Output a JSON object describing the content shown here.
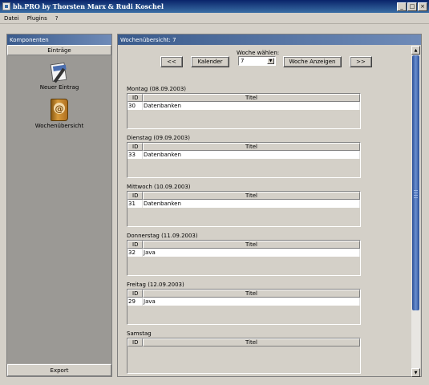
{
  "window": {
    "title": "bh.PRO by Thorsten Marx & Rudi Koschel",
    "min": "_",
    "max": "□",
    "close": "×"
  },
  "menu": [
    "Datei",
    "Plugins",
    "?"
  ],
  "left": {
    "header": "Komponenten",
    "tab": "Einträge",
    "items": [
      {
        "label": "Neuer Eintrag",
        "icon": "new-entry-icon"
      },
      {
        "label": "Wochenübersicht",
        "icon": "week-overview-icon"
      }
    ],
    "export": "Export"
  },
  "right": {
    "header": "Wochenübersicht: 7",
    "prev": "<<",
    "calendar": "Kalender",
    "week_label": "Woche wählen:",
    "week_value": "7",
    "show": "Woche Anzeigen",
    "next": ">>",
    "col_id": "ID",
    "col_title": "Titel",
    "days": [
      {
        "title": "Montag (08.09.2003)",
        "rows": [
          {
            "id": "30",
            "title": "Datenbanken"
          }
        ]
      },
      {
        "title": "Dienstag (09.09.2003)",
        "rows": [
          {
            "id": "33",
            "title": "Datenbanken"
          }
        ]
      },
      {
        "title": "Mittwoch (10.09.2003)",
        "rows": [
          {
            "id": "31",
            "title": "Datenbanken"
          }
        ]
      },
      {
        "title": "Donnerstag (11.09.2003)",
        "rows": [
          {
            "id": "32",
            "title": "Java"
          }
        ]
      },
      {
        "title": "Freitag (12.09.2003)",
        "rows": [
          {
            "id": "29",
            "title": "Java"
          }
        ]
      },
      {
        "title": "Samstag",
        "rows": []
      }
    ]
  }
}
